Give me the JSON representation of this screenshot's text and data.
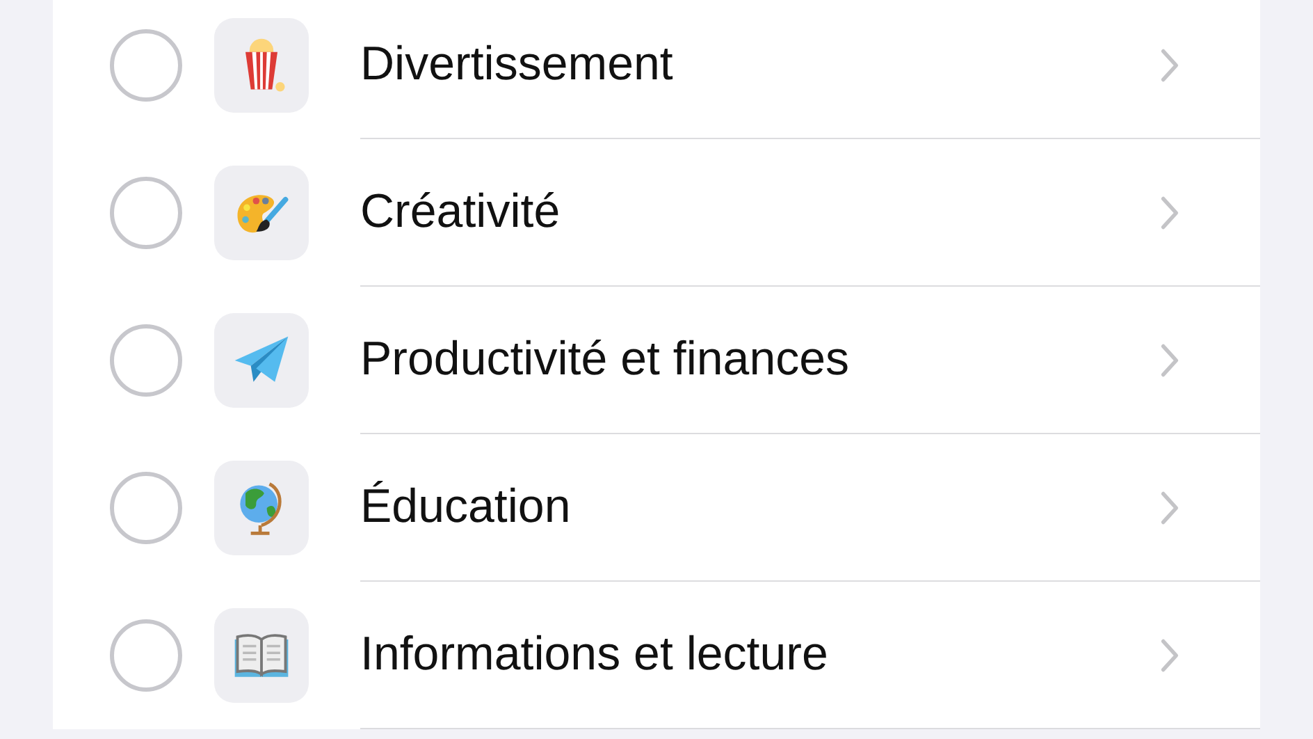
{
  "categories": [
    {
      "label": "Divertissement",
      "selected": false
    },
    {
      "label": "Créativité",
      "selected": false
    },
    {
      "label": "Productivité et finances",
      "selected": false
    },
    {
      "label": "Éducation",
      "selected": false
    },
    {
      "label": "Informations et lecture",
      "selected": false
    }
  ]
}
